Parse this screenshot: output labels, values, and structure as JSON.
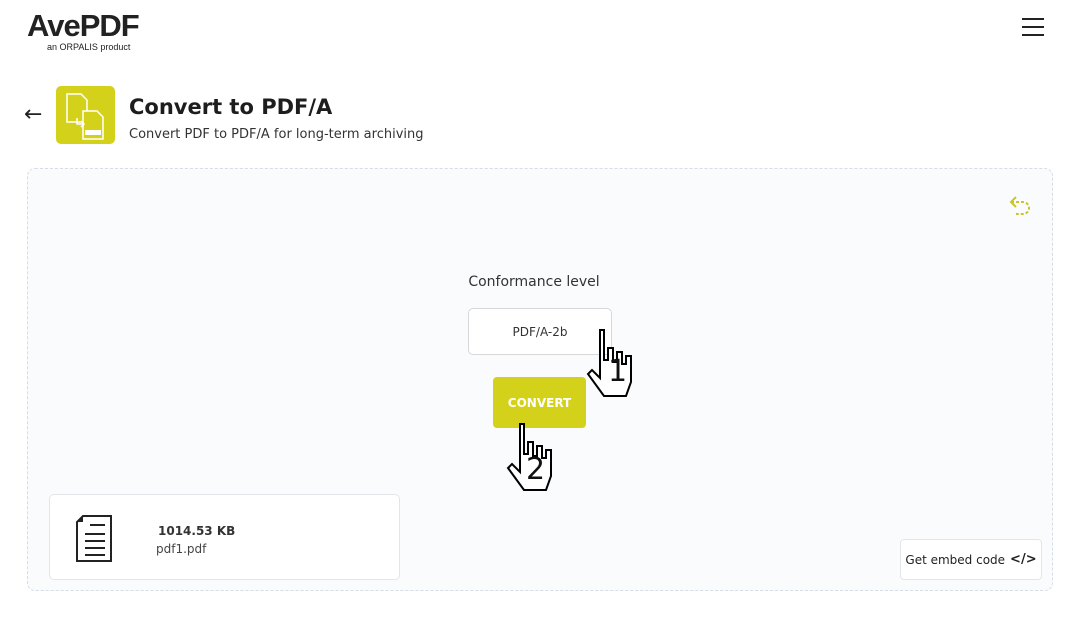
{
  "header": {
    "logo_text": "AvePDF",
    "logo_sub": "an ORPALIS product",
    "menu_icon": "hamburger-icon"
  },
  "tool": {
    "title": "Convert to PDF/A",
    "subtitle": "Convert PDF to PDF/A for long-term archiving",
    "icon": "pdfa-convert-icon",
    "accent": "#d4d11a"
  },
  "options": {
    "conformance_label": "Conformance level",
    "conformance_value": "PDF/A-2b",
    "convert_label": "CONVERT"
  },
  "file": {
    "size": "1014.53 KB",
    "name": "pdf1.pdf"
  },
  "embed": {
    "label": "Get embed code",
    "icon": "</>"
  },
  "annotations": {
    "step1": "1",
    "step2": "2"
  }
}
